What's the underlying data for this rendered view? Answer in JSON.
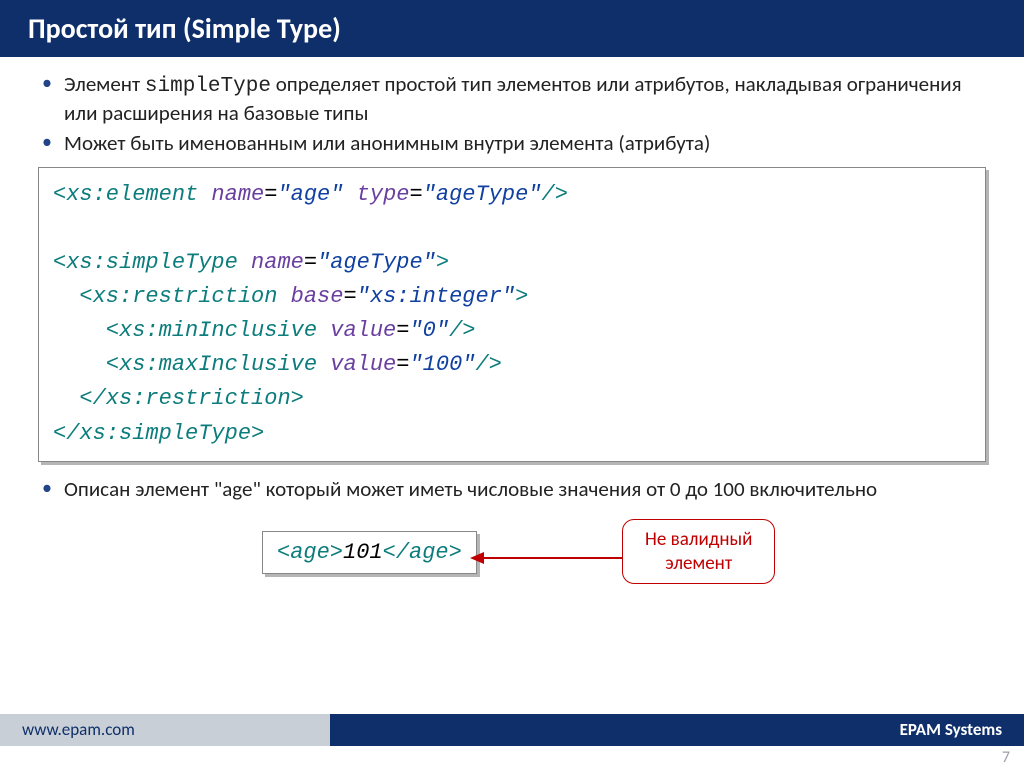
{
  "header": {
    "title": "Простой тип (Simple Type)"
  },
  "bullets": {
    "b1a": "Элемент ",
    "b1mono": "simpleType",
    "b1b": " определяет простой тип элементов или атрибутов, накладывая ограничения или расширения на базовые типы",
    "b2": "Может быть именованным или анонимным внутри элемента (атрибута)",
    "b3a": "Описан элемент  ",
    "b3q": "\"age\"",
    "b3b": "  который может иметь числовые значения от 0 до 100 включительно"
  },
  "code": {
    "l1_t1": "<xs:element",
    "l1_a1": " name",
    "l1_eq1": "=",
    "l1_v1": "\"age\"",
    "l1_a2": "  type",
    "l1_eq2": "=",
    "l1_v2": "\"ageType\"",
    "l1_t2": "/>",
    "l3_t1": "<xs:simpleType",
    "l3_a1": " name",
    "l3_eq": "=",
    "l3_v1": "\"ageType\"",
    "l3_t2": ">",
    "l4_pad": "  ",
    "l4_t1": "<xs:restriction",
    "l4_a1": " base",
    "l4_eq": "=",
    "l4_v1": "\"xs:integer\"",
    "l4_t2": ">",
    "l5_pad": "    ",
    "l5_t1": "<xs:minInclusive",
    "l5_a1": " value",
    "l5_eq": "=",
    "l5_v1": "\"0\"",
    "l5_t2": "/>",
    "l6_pad": "    ",
    "l6_t1": "<xs:maxInclusive",
    "l6_a1": " value",
    "l6_eq": "=",
    "l6_v1": "\"100\"",
    "l6_t2": "/>",
    "l7_pad": "  ",
    "l7_t1": "</xs:restriction>",
    "l8_t1": "</xs:simpleType>"
  },
  "invalid": {
    "open": "<age>",
    "num": "101",
    "close": "</age>",
    "callout_l1": "Не валидный",
    "callout_l2": "элемент"
  },
  "footer": {
    "url": "www.epam.com",
    "company": "EPAM Systems",
    "page": "7"
  }
}
